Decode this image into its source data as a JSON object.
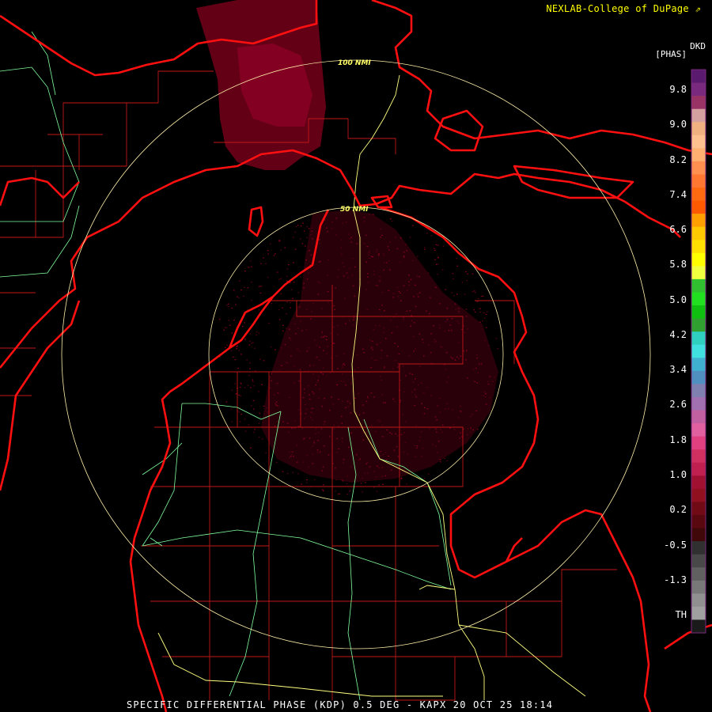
{
  "header": {
    "credit": "NEXLAB-College of DuPage",
    "credit_logo": "cod-arrow-icon"
  },
  "legend": {
    "unit": "DKD",
    "product": "[PHAS]",
    "labels": [
      "9.8",
      "9.0",
      "8.2",
      "7.4",
      "6.6",
      "5.8",
      "5.0",
      "4.2",
      "3.4",
      "2.6",
      "1.8",
      "1.0",
      "0.2",
      "-0.5",
      "-1.3",
      "TH"
    ],
    "colors": [
      "#5a1a6e",
      "#7a2a7e",
      "#993366",
      "#d4a0a0",
      "#f0b080",
      "#ffc090",
      "#ffb070",
      "#ff9050",
      "#ff7730",
      "#ff6a10",
      "#ff5a00",
      "#ffa000",
      "#ffc800",
      "#ffe000",
      "#ffff00",
      "#f0ff40",
      "#30c030",
      "#20e020",
      "#10c010",
      "#30a030",
      "#30d0c0",
      "#40e0e0",
      "#40b0d0",
      "#5090c0",
      "#8080b0",
      "#a070b0",
      "#c060a0",
      "#e060a0",
      "#e04080",
      "#d03060",
      "#c02050",
      "#a01030",
      "#901020",
      "#700a14",
      "#5a0810",
      "#400808",
      "#303030",
      "#484848",
      "#606060",
      "#787878",
      "#909090",
      "#a0a0a0",
      "#1a1a1a"
    ]
  },
  "radar": {
    "ring_labels": [
      "50 NMI",
      "100 NMI"
    ],
    "colors": {
      "coast": "#ff1010",
      "county": "#c01818",
      "highway": "#ffff80",
      "river": "#80ffa0",
      "ring": "#ffeeaa",
      "echo": "#6e0018"
    }
  },
  "footer": {
    "title": "SPECIFIC DIFFERENTIAL PHASE (KDP) 0.5 DEG - KAPX 20 OCT 25 18:14"
  }
}
